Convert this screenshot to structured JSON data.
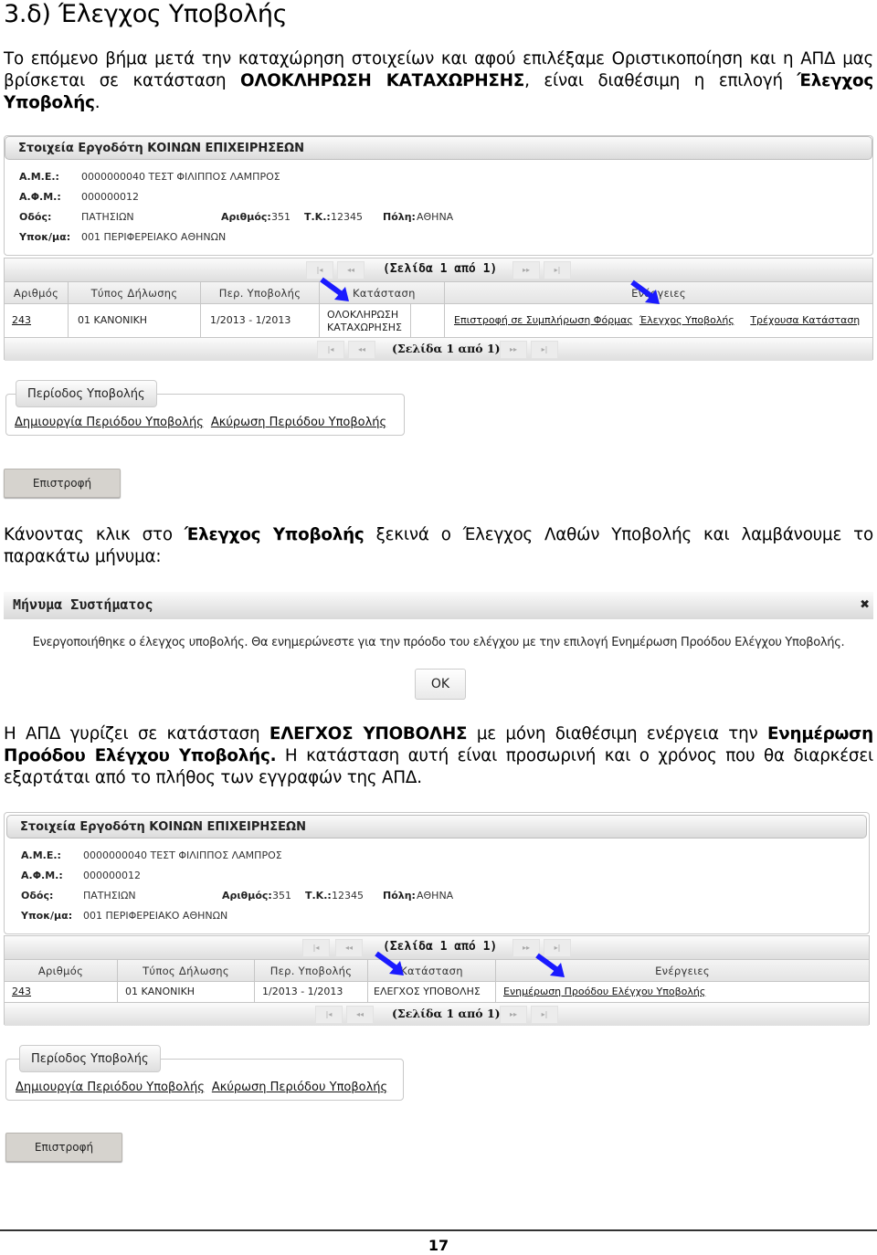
{
  "heading": "3.δ) Έλεγχος Υποβολής",
  "para1": {
    "t1": "Το επόμενο βήμα μετά την καταχώρηση στοιχείων και αφού επιλέξαμε Οριστικοποίηση και η ΑΠΔ μας βρίσκεται σε κατάσταση ",
    "b1": "ΟΛΟΚΛΗΡΩΣΗ ΚΑΤΑΧΩΡΗΣΗΣ",
    "t2": ", είναι διαθέσιμη η επιλογή ",
    "b2": "Έλεγχος Υποβολής",
    "t3": "."
  },
  "para2": {
    "t1": "Κάνοντας κλικ στο ",
    "b1": "Έλεγχος Υποβολής",
    "t2": " ξεκινά ο Έλεγχος Λαθών Υποβολής και λαμβάνουμε το παρακάτω μήνυμα:"
  },
  "para3": {
    "t1": "Η ΑΠΔ γυρίζει σε κατάσταση ",
    "b1": "ΕΛΕΓΧΟΣ ΥΠΟΒΟΛΗΣ",
    "t2": " με μόνη διαθέσιμη ενέργεια την ",
    "b2": "Ενημέρωση Προόδου Ελέγχου Υποβολής.",
    "t3": " Η κατάσταση αυτή είναι προσωρινή και ο χρόνος που θα διαρκέσει εξαρτάται από το πλήθος των εγγραφών της ΑΠΔ."
  },
  "employer": {
    "title": "Στοιχεία Εργοδότη ΚΟΙΝΩΝ ΕΠΙΧΕΙΡΗΣΕΩΝ",
    "ame_label": "Α.Μ.Ε.:",
    "ame_value": "0000000040 ΤΕΣΤ ΦΙΛΙΠΠΟΣ ΛΑΜΠΡΟΣ",
    "afm_label": "Α.Φ.Μ.:",
    "afm_value": "000000012",
    "street_label": "Οδός:",
    "street_value": "ΠΑΤΗΣΙΩΝ",
    "number_label": "Αριθμός:",
    "number_value": "351",
    "tk_label": "Τ.Κ.:",
    "tk_value": "12345",
    "city_label": "Πόλη:",
    "city_value": "ΑΘΗΝΑ",
    "branch_label": "Υποκ/μα:",
    "branch_value": "001 ΠΕΡΙΦΕΡΕΙΑΚΟ ΑΘΗΝΩΝ"
  },
  "pager": {
    "text": "(Σελίδα 1 από 1)",
    "first_icon": "first-page-icon",
    "prev_icon": "prev-page-icon",
    "next_icon": "next-page-icon",
    "last_icon": "last-page-icon",
    "first_glyph": "|◂",
    "prev_glyph": "◂◂",
    "next_glyph": "▸▸",
    "last_glyph": "▸|"
  },
  "grid1": {
    "headers": [
      "Αριθμός",
      "Τύπος Δήλωσης",
      "Περ. Υποβολής",
      "Κατάσταση",
      "Ενέργειες"
    ],
    "row": {
      "number": "243",
      "type": "01 ΚΑΝΟΝΙΚΗ",
      "period": "1/2013 - 1/2013",
      "status": "ΟΛΟΚΛΗΡΩΣΗ ΚΑΤΑΧΩΡΗΣΗΣ",
      "actions": [
        "Επιστροφή σε Συμπλήρωση Φόρμας",
        "Έλεγχος Υποβολής",
        "Τρέχουσα Κατάσταση"
      ]
    }
  },
  "grid2": {
    "headers": [
      "Αριθμός",
      "Τύπος Δήλωσης",
      "Περ. Υποβολής",
      "Κατάσταση",
      "Ενέργειες"
    ],
    "row": {
      "number": "243",
      "type": "01 ΚΑΝΟΝΙΚΗ",
      "period": "1/2013 - 1/2013",
      "status": "ΕΛΕΓΧΟΣ ΥΠΟΒΟΛΗΣ",
      "actions": [
        "Ενημέρωση Προόδου Ελέγχου Υποβολής"
      ]
    }
  },
  "period_box": {
    "tab": "Περίοδος Υποβολής",
    "links": [
      "Δημιουργία Περιόδου Υποβολής",
      "Ακύρωση Περιόδου Υποβολής"
    ]
  },
  "back_button": "Επιστροφή",
  "dialog": {
    "title": "Μήνυμα Συστήματος",
    "close_glyph": "✖",
    "message": "Ενεργοποιήθηκε ο έλεγχος υποβολής. Θα ενημερώνεστε για την πρόοδο του ελέγχου με την επιλογή Ενημέρωση Προόδου Ελέγχου Υποβολής.",
    "ok": "OK"
  },
  "annotation_color": "#1a1aff",
  "page_number": "17"
}
